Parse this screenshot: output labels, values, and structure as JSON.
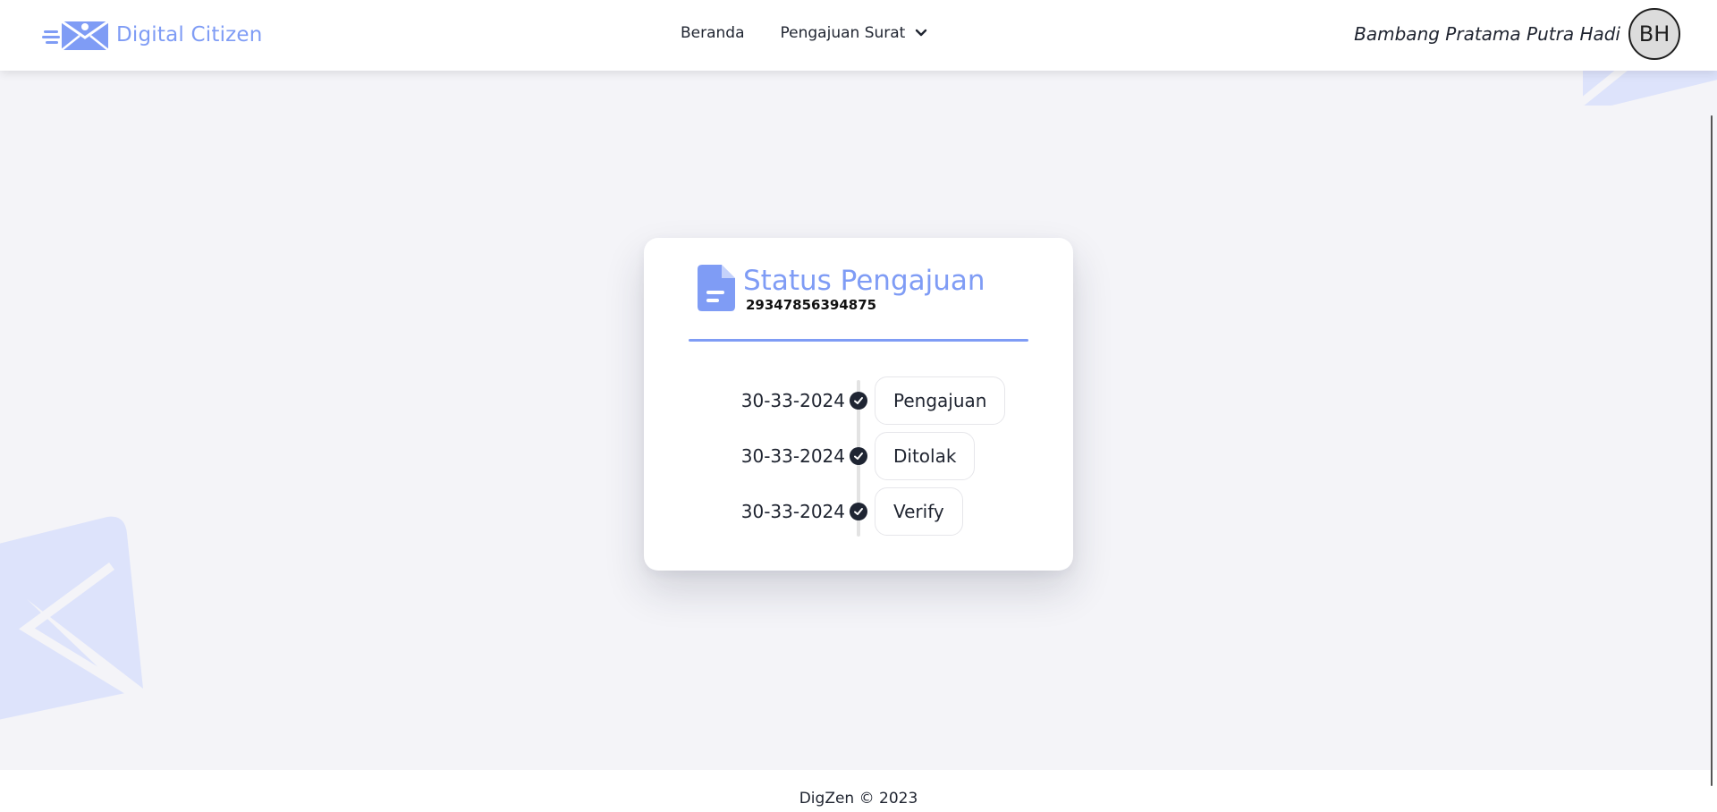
{
  "app": {
    "brand_name": "Digital Citizen",
    "brand_icon": "envelope-logo-icon",
    "accent_color": "#7f9cf5"
  },
  "nav": {
    "items": [
      {
        "label": "Beranda"
      },
      {
        "label": "Pengajuan Surat",
        "icon": "chevron-down-icon"
      }
    ]
  },
  "user": {
    "name": "Bambang Pratama Putra Hadi",
    "initials": "BH"
  },
  "status_card": {
    "icon": "document-icon",
    "title": "Status Pengajuan",
    "number": "29347856394875",
    "timeline": [
      {
        "date": "30-33-2024",
        "status": "Pengajuan",
        "icon": "check-circle-icon"
      },
      {
        "date": "30-33-2024",
        "status": "Ditolak",
        "icon": "check-circle-icon"
      },
      {
        "date": "30-33-2024",
        "status": "Verify",
        "icon": "check-circle-icon"
      }
    ]
  },
  "footer": {
    "text": "DigZen © 2023"
  }
}
